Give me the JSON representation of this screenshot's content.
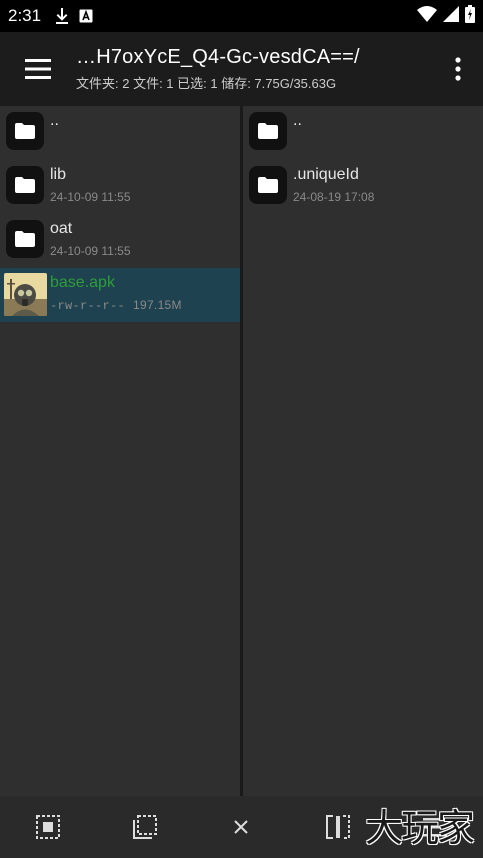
{
  "statusbar": {
    "time": "2:31"
  },
  "appbar": {
    "title": "…H7oxYcE_Q4-Gc-vesdCA==/",
    "subtitle": "文件夹: 2  文件: 1  已选: 1  储存: 7.75G/35.63G"
  },
  "left_pane": {
    "items": [
      {
        "name": "..",
        "meta": ""
      },
      {
        "name": "lib",
        "meta": "24-10-09 11:55"
      },
      {
        "name": "oat",
        "meta": "24-10-09 11:55"
      },
      {
        "name": "base.apk",
        "meta": "-rw-r--r--",
        "size": "197.15M",
        "selected": true
      }
    ]
  },
  "right_pane": {
    "items": [
      {
        "name": "..",
        "meta": ""
      },
      {
        "name": ".uniqueId",
        "meta": "24-08-19 17:08"
      }
    ]
  },
  "watermark": "大玩家",
  "colors": {
    "selected_row": "#1f4250",
    "apk_name": "#2e9d3a",
    "pane_bg": "#2f2f2f",
    "appbar_bg": "#1c1c1c"
  }
}
